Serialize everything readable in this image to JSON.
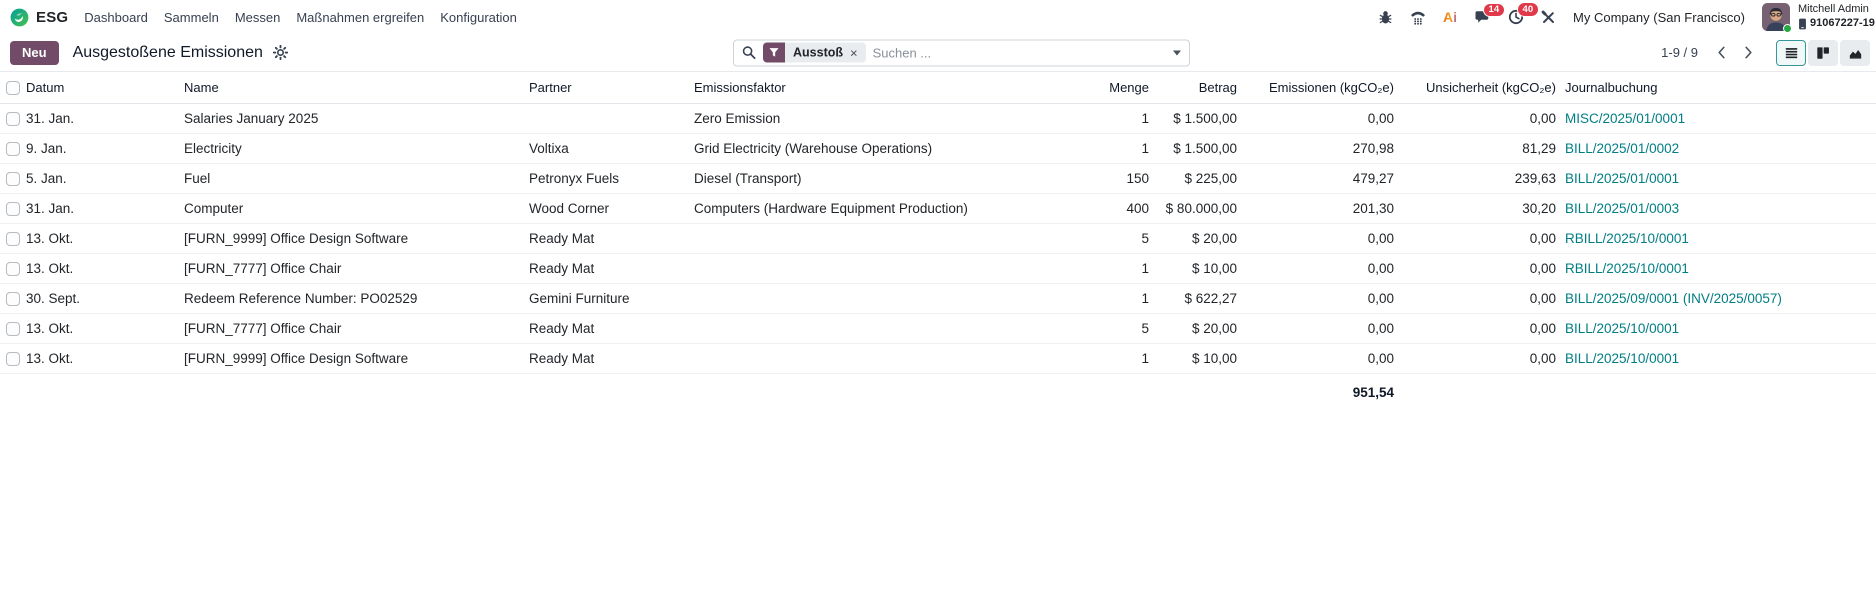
{
  "navbar": {
    "brand": "ESG",
    "menus": [
      "Dashboard",
      "Sammeln",
      "Messen",
      "Maßnahmen ergreifen",
      "Konfiguration"
    ],
    "systray": {
      "chat_badge": "14",
      "activity_badge": "40",
      "company": "My Company (San Francisco)",
      "user_name": "Mitchell Admin",
      "user_phone": "91067227-19"
    }
  },
  "control_panel": {
    "new_button": "Neu",
    "title": "Ausgestoßene Emissionen",
    "search": {
      "facet": "Ausstoß",
      "remove": "×",
      "placeholder": "Suchen ..."
    },
    "pager": {
      "text": "1-9 / 9"
    }
  },
  "table": {
    "columns": [
      "Datum",
      "Name",
      "Partner",
      "Emissionsfaktor",
      "Menge",
      "Betrag",
      "Emissionen (kgCO₂e)",
      "Unsicherheit (kgCO₂e)",
      "Journalbuchung"
    ],
    "rows": [
      {
        "date": "31. Jan.",
        "name": "Salaries January 2025",
        "partner": "",
        "factor": "Zero Emission",
        "qty": "1",
        "amount": "$ 1.500,00",
        "emissions": "0,00",
        "uncertainty": "0,00",
        "journal": "MISC/2025/01/0001"
      },
      {
        "date": "9. Jan.",
        "name": "Electricity",
        "partner": "Voltixa",
        "factor": "Grid Electricity (Warehouse Operations)",
        "qty": "1",
        "amount": "$ 1.500,00",
        "emissions": "270,98",
        "uncertainty": "81,29",
        "journal": "BILL/2025/01/0002"
      },
      {
        "date": "5. Jan.",
        "name": "Fuel",
        "partner": "Petronyx Fuels",
        "factor": "Diesel (Transport)",
        "qty": "150",
        "amount": "$ 225,00",
        "emissions": "479,27",
        "uncertainty": "239,63",
        "journal": "BILL/2025/01/0001"
      },
      {
        "date": "31. Jan.",
        "name": "Computer",
        "partner": "Wood Corner",
        "factor": "Computers (Hardware Equipment Production)",
        "qty": "400",
        "amount": "$ 80.000,00",
        "emissions": "201,30",
        "uncertainty": "30,20",
        "journal": "BILL/2025/01/0003"
      },
      {
        "date": "13. Okt.",
        "name": "[FURN_9999] Office Design Software",
        "partner": "Ready Mat",
        "factor": "",
        "qty": "5",
        "amount": "$ 20,00",
        "emissions": "0,00",
        "uncertainty": "0,00",
        "journal": "RBILL/2025/10/0001"
      },
      {
        "date": "13. Okt.",
        "name": "[FURN_7777] Office Chair",
        "partner": "Ready Mat",
        "factor": "",
        "qty": "1",
        "amount": "$ 10,00",
        "emissions": "0,00",
        "uncertainty": "0,00",
        "journal": "RBILL/2025/10/0001"
      },
      {
        "date": "30. Sept.",
        "name": "Redeem Reference Number: PO02529",
        "partner": "Gemini Furniture",
        "factor": "",
        "qty": "1",
        "amount": "$ 622,27",
        "emissions": "0,00",
        "uncertainty": "0,00",
        "journal": "BILL/2025/09/0001 (INV/2025/0057)"
      },
      {
        "date": "13. Okt.",
        "name": "[FURN_7777] Office Chair",
        "partner": "Ready Mat",
        "factor": "",
        "qty": "5",
        "amount": "$ 20,00",
        "emissions": "0,00",
        "uncertainty": "0,00",
        "journal": "BILL/2025/10/0001"
      },
      {
        "date": "13. Okt.",
        "name": "[FURN_9999] Office Design Software",
        "partner": "Ready Mat",
        "factor": "",
        "qty": "1",
        "amount": "$ 10,00",
        "emissions": "0,00",
        "uncertainty": "0,00",
        "journal": "BILL/2025/10/0001"
      }
    ],
    "total_emissions": "951,54"
  },
  "icons": {
    "logo": "esg-leaf-circle",
    "systray": [
      "bug-icon",
      "softphone-icon",
      "ai-icon",
      "chat-icon",
      "activity-clock-icon",
      "tools-icon"
    ],
    "title_action": "gear-icon",
    "search": [
      "search-icon",
      "filter-funnel-icon",
      "caret-down-icon"
    ],
    "pager": [
      "chevron-left-icon",
      "chevron-right-icon"
    ],
    "view_switcher": [
      "list-view-icon",
      "kanban-view-icon",
      "graph-view-icon"
    ],
    "user": [
      "mobile-phone-icon"
    ]
  },
  "colors": {
    "primary": "#714B67",
    "link": "#017e84",
    "badge": "#e0394a",
    "active_view_border": "#35979b"
  }
}
